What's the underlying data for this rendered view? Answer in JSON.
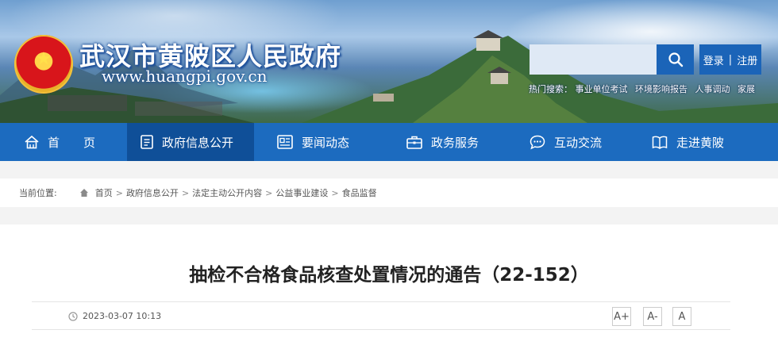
{
  "header": {
    "site_title": "武汉市黄陂区人民政府",
    "site_url": "www.huangpi.gov.cn",
    "search": {
      "placeholder": "",
      "value": ""
    },
    "login": "登录",
    "register": "注册",
    "login_sep": "|",
    "hot_label": "热门搜索：",
    "hot_items": [
      "事业单位考试",
      "环境影响报告",
      "人事调动",
      "家展"
    ]
  },
  "nav": {
    "items": [
      {
        "label": "首　　页",
        "icon": "home-icon"
      },
      {
        "label": "政府信息公开",
        "icon": "document-icon",
        "active": true
      },
      {
        "label": "要闻动态",
        "icon": "news-icon"
      },
      {
        "label": "政务服务",
        "icon": "briefcase-icon"
      },
      {
        "label": "互动交流",
        "icon": "chat-icon"
      },
      {
        "label": "走进黄陂",
        "icon": "book-icon"
      }
    ]
  },
  "breadcrumb": {
    "lead": "当前位置:",
    "items": [
      "首页",
      "政府信息公开",
      "法定主动公开内容",
      "公益事业建设",
      "食品监督"
    ],
    "sep": ">"
  },
  "article": {
    "title": "抽检不合格食品核查处置情况的通告（22-152）",
    "date": "2023-03-07 10:13",
    "font_sizes": [
      "A+",
      "A-",
      "A"
    ]
  },
  "colors": {
    "nav": "#1c6bbf",
    "nav_active": "#0f4f98",
    "accent": "#1b64b8"
  }
}
